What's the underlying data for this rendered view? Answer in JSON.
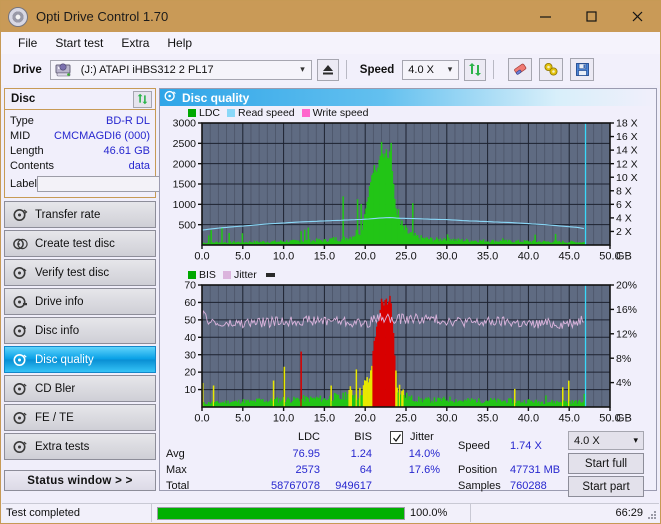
{
  "window": {
    "title": "Opti Drive Control 1.70",
    "icon": "disc-icon",
    "minimize": "minimize-icon",
    "maximize": "maximize-icon",
    "close": "close-icon",
    "titlebar_color": "#c99a57"
  },
  "menu": {
    "items": [
      "File",
      "Start test",
      "Extra",
      "Help"
    ]
  },
  "toolbar": {
    "drive_label": "Drive",
    "drive_value": "(J:)  ATAPI iHBS312  2 PL17",
    "eject_icon": "eject-icon",
    "speed_label": "Speed",
    "speed_value": "4.0 X",
    "refresh_icon": "refresh-icon",
    "erase_icon": "eraser-icon",
    "tools_icon": "tools-icon",
    "save_icon": "save-icon"
  },
  "disc_panel": {
    "title": "Disc",
    "refresh_icon": "refresh-icon",
    "rows": [
      {
        "key": "Type",
        "value": "BD-R DL"
      },
      {
        "key": "MID",
        "value": "CMCMAGDI6 (000)"
      },
      {
        "key": "Length",
        "value": "46.61 GB"
      },
      {
        "key": "Contents",
        "value": "data"
      }
    ],
    "label_key": "Label",
    "label_value": "",
    "label_placeholder": "",
    "label_button_icon": "disc-icon"
  },
  "sidebar": {
    "items": [
      {
        "label": "Transfer rate",
        "icon": "disc-speed-icon",
        "selected": false
      },
      {
        "label": "Create test disc",
        "icon": "disc-write-icon",
        "selected": false
      },
      {
        "label": "Verify test disc",
        "icon": "disc-verify-icon",
        "selected": false
      },
      {
        "label": "Drive info",
        "icon": "drive-info-icon",
        "selected": false
      },
      {
        "label": "Disc info",
        "icon": "disc-info-icon",
        "selected": false
      },
      {
        "label": "Disc quality",
        "icon": "disc-quality-icon",
        "selected": true
      },
      {
        "label": "CD Bler",
        "icon": "cd-bler-icon",
        "selected": false
      },
      {
        "label": "FE / TE",
        "icon": "fe-te-icon",
        "selected": false
      },
      {
        "label": "Extra tests",
        "icon": "extra-tests-icon",
        "selected": false
      }
    ],
    "status_window_button": "Status window > >"
  },
  "chart_panel": {
    "title": "Disc quality",
    "icon": "disc-quality-icon"
  },
  "chart_data": [
    {
      "type": "area",
      "title": "Disc quality - LDC",
      "xlabel": "GB",
      "ylabel": "LDC",
      "xlim": [
        0,
        50
      ],
      "ylim": [
        0,
        3000
      ],
      "y2lim": [
        0,
        18
      ],
      "y2label": "X",
      "xticks": [
        "0.0",
        "5.0",
        "10.0",
        "15.0",
        "20.0",
        "25.0",
        "30.0",
        "35.0",
        "40.0",
        "45.0",
        "50.0"
      ],
      "yticks": [
        "500",
        "1000",
        "1500",
        "2000",
        "2500",
        "3000"
      ],
      "y2ticks": [
        "2 X",
        "4 X",
        "6 X",
        "8 X",
        "10 X",
        "12 X",
        "14 X",
        "16 X",
        "18 X"
      ],
      "grid": true,
      "legend_position": "top-left",
      "legend": [
        {
          "name": "LDC",
          "color": "#00a800"
        },
        {
          "name": "Read speed",
          "color": "#8ad8f8"
        },
        {
          "name": "Write speed",
          "color": "#ff66cc"
        }
      ],
      "series": [
        {
          "name": "LDC",
          "color": "#22c516",
          "x": [
            0,
            1,
            2,
            3,
            4,
            5,
            6,
            7,
            8,
            9,
            10,
            11,
            12,
            13,
            14,
            15,
            16,
            17,
            18,
            19,
            19.5,
            20,
            20.5,
            21,
            21.3,
            21.6,
            21.9,
            22.2,
            22.5,
            22.8,
            23.1,
            23.2,
            23.4,
            23.6,
            23.9,
            24.2,
            24.5,
            25,
            25.5,
            26,
            27,
            28,
            29,
            30,
            31,
            32,
            33,
            34,
            35,
            36,
            37,
            38,
            39,
            40,
            41,
            42,
            43,
            44,
            45,
            46,
            46.6
          ],
          "y": [
            55,
            60,
            70,
            65,
            75,
            70,
            80,
            75,
            85,
            80,
            95,
            90,
            105,
            100,
            115,
            110,
            150,
            140,
            190,
            320,
            520,
            900,
            1480,
            1900,
            1750,
            2100,
            2450,
            2250,
            2400,
            2100,
            2560,
            1900,
            1400,
            980,
            700,
            520,
            420,
            320,
            260,
            210,
            160,
            140,
            130,
            190,
            120,
            115,
            110,
            105,
            100,
            98,
            95,
            92,
            90,
            88,
            85,
            82,
            80,
            78,
            75,
            72,
            70
          ]
        },
        {
          "name": "Read speed",
          "color": "#8ad8f8",
          "x": [
            0,
            2,
            4,
            6,
            8,
            10,
            12,
            14,
            16,
            18,
            20,
            22,
            23.2,
            24,
            26,
            28,
            30,
            32,
            34,
            36,
            38,
            40,
            42,
            44,
            46,
            46.9
          ],
          "y_speed_x": [
            2.2,
            2.5,
            2.7,
            2.9,
            3.1,
            3.25,
            3.4,
            3.5,
            3.6,
            3.7,
            3.8,
            4.0,
            4.05,
            3.95,
            3.9,
            3.8,
            3.75,
            3.6,
            3.5,
            3.4,
            3.3,
            3.15,
            3.0,
            2.8,
            2.6,
            2.4
          ]
        }
      ],
      "end_marker_x": 47.0,
      "end_marker_color": "#39d8f8",
      "plot_bg": "#5f6b82",
      "grid_color": "#1d2230"
    },
    {
      "type": "area",
      "title": "Disc quality - BIS / Jitter",
      "xlabel": "GB",
      "ylabel": "BIS",
      "xlim": [
        0,
        50
      ],
      "ylim": [
        0,
        70
      ],
      "y2lim": [
        0,
        20
      ],
      "y2label": "%",
      "xticks": [
        "0.0",
        "5.0",
        "10.0",
        "15.0",
        "20.0",
        "25.0",
        "30.0",
        "35.0",
        "40.0",
        "45.0",
        "50.0"
      ],
      "yticks": [
        "10",
        "20",
        "30",
        "40",
        "50",
        "60",
        "70"
      ],
      "y2ticks": [
        "4%",
        "8%",
        "12%",
        "16%",
        "20%"
      ],
      "grid": true,
      "legend_position": "top-left",
      "legend": [
        {
          "name": "BIS",
          "color": "#00a800"
        },
        {
          "name": "Jitter",
          "color": "#dbb4dd"
        }
      ],
      "series": [
        {
          "name": "BIS",
          "color": "#22c516",
          "x": [
            0,
            1,
            2,
            3,
            4,
            5,
            6,
            7,
            8,
            9,
            10,
            11,
            12,
            13,
            14,
            15,
            16,
            17,
            18,
            19,
            19.6,
            20.2,
            20.7,
            21.0,
            21.3,
            21.6,
            21.9,
            22.2,
            22.5,
            22.8,
            23.0,
            23.2,
            23.4,
            23.6,
            23.9,
            24.2,
            24.6,
            25,
            25.5,
            26,
            27,
            28,
            29,
            30,
            31,
            32,
            33,
            34,
            35,
            36,
            37,
            38,
            39,
            40,
            41,
            42,
            43,
            44,
            45,
            46,
            46.6
          ],
          "y": [
            2,
            2.5,
            2.5,
            3,
            3,
            3.5,
            3,
            4,
            3.5,
            4,
            4.5,
            4,
            5,
            4.5,
            5,
            4.5,
            6,
            5,
            9,
            6,
            11,
            14,
            22,
            38,
            44,
            52,
            60,
            57,
            62,
            59,
            64,
            56,
            40,
            24,
            14,
            10,
            8,
            6,
            5,
            4.5,
            4,
            4,
            4,
            4.5,
            4,
            3.5,
            4,
            3.5,
            4,
            3.5,
            3.5,
            3.5,
            3,
            3.5,
            3,
            3,
            3,
            3,
            3,
            3,
            3
          ]
        },
        {
          "name": "Jitter",
          "color": "#dbb4dd",
          "noise": true,
          "x": [
            0,
            2,
            4,
            6,
            8,
            10,
            12,
            14,
            16,
            18,
            20,
            21,
            22,
            23,
            23.5,
            24,
            26,
            28,
            30,
            32,
            34,
            36,
            38,
            40,
            42,
            44,
            46,
            46.8
          ],
          "y_pct": [
            15.0,
            13.4,
            13.6,
            13.8,
            13.9,
            14.0,
            14.2,
            14.1,
            14.3,
            13.9,
            13.7,
            14.2,
            14.8,
            14.6,
            13.8,
            14.4,
            14.5,
            14.4,
            14.2,
            14.0,
            13.8,
            14.0,
            13.9,
            13.5,
            13.7,
            13.6,
            14.0,
            14.6
          ]
        }
      ],
      "peak_overlay_color": "#d80000",
      "mid_overlay_color": "#e8e800",
      "end_marker_x": 47.0,
      "end_marker_color": "#39d8f8",
      "plot_bg": "#5f6b82",
      "grid_color": "#1d2230"
    }
  ],
  "stats": {
    "col_headers": [
      "LDC",
      "BIS"
    ],
    "jitter_label": "Jitter",
    "jitter_checked": true,
    "rows": [
      {
        "label": "Avg",
        "ldc": "76.95",
        "bis": "1.24",
        "jitter": "14.0%"
      },
      {
        "label": "Max",
        "ldc": "2573",
        "bis": "64",
        "jitter": "17.6%"
      },
      {
        "label": "Total",
        "ldc": "58767078",
        "bis": "949617",
        "jitter": ""
      }
    ],
    "speed_label": "Speed",
    "speed_value": "1.74 X",
    "position_label": "Position",
    "position_value": "47731 MB",
    "samples_label": "Samples",
    "samples_value": "760288",
    "speed_select": "4.0 X",
    "start_full_button": "Start full",
    "start_part_button": "Start part"
  },
  "statusbar": {
    "text": "Test completed",
    "progress_percent": "100.0%",
    "progress_value": 100,
    "elapsed": "66:29",
    "progress_color": "#00b000"
  }
}
